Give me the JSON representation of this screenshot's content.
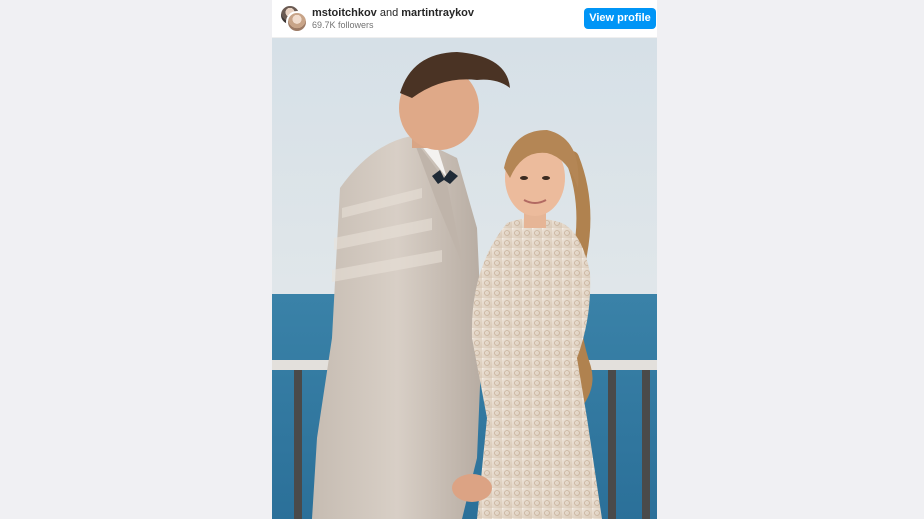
{
  "header": {
    "user1": "mstoitchkov",
    "joiner": " and ",
    "user2": "martintraykov",
    "followers": "69.7K followers",
    "view_profile_label": "View profile"
  },
  "colors": {
    "accent": "#0095f6",
    "page_bg": "#f0f0f3"
  },
  "photo": {
    "description_icon": "wedding-couple-photo"
  }
}
